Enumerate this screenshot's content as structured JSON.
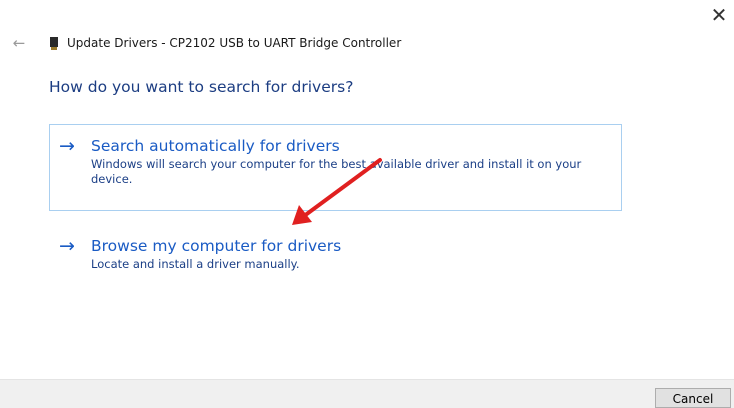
{
  "window": {
    "title": "Update Drivers - CP2102 USB to UART Bridge Controller",
    "close_glyph": "✕",
    "back_glyph": "←"
  },
  "content": {
    "question": "How do you want to search for drivers?",
    "options": [
      {
        "arrow": "→",
        "title": "Search automatically for drivers",
        "description": "Windows will search your computer for the best available driver and install it on your device."
      },
      {
        "arrow": "→",
        "title": "Browse my computer for drivers",
        "description": "Locate and install a driver manually."
      }
    ]
  },
  "footer": {
    "cancel_label": "Cancel"
  },
  "colors": {
    "accent_link": "#1a5bc4",
    "heading": "#1c3d82",
    "selection_border": "#a9cff0",
    "annotation_arrow": "#e02020"
  },
  "icons": {
    "device": "usb-device-icon",
    "back": "back-arrow-icon",
    "close": "close-icon",
    "option_arrow": "right-arrow-icon"
  }
}
